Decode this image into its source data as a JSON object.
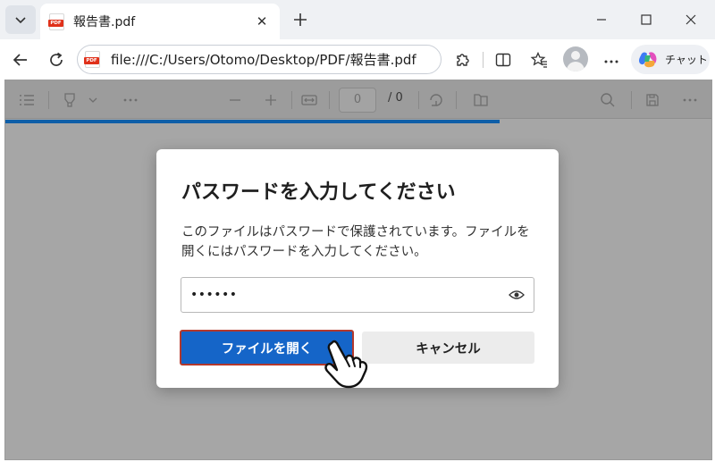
{
  "tab": {
    "title": "報告書.pdf",
    "close_symbol": "✕",
    "badge_text": "PDF"
  },
  "address": {
    "url": "file:///C:/Users/Otomo/Desktop/PDF/報告書.pdf"
  },
  "copilot": {
    "label": "チャット"
  },
  "pdf_toolbar": {
    "page_input_placeholder": "0",
    "page_total": "/ 0",
    "load_progress": 0.7
  },
  "dialog": {
    "title": "パスワードを入力してください",
    "message": "このファイルはパスワードで保護されています。ファイルを開くにはパスワードを入力してください。",
    "password_value": "••••••",
    "open_label": "ファイルを開く",
    "cancel_label": "キャンセル"
  },
  "colors": {
    "primary_button": "#1565c8",
    "highlight_border": "#b3382c",
    "progress": "#0f5fa8"
  }
}
